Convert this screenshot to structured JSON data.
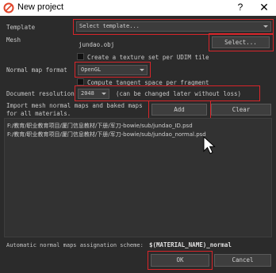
{
  "window": {
    "title": "New project",
    "help_label": "?",
    "close_label": "✕"
  },
  "template": {
    "label": "Template",
    "value": "Select template..."
  },
  "mesh": {
    "label": "Mesh",
    "value": "jundao.obj",
    "select_label": "Select..."
  },
  "udim": {
    "label": "Create a texture set per UDIM tile"
  },
  "normal_map": {
    "label": "Normal map format",
    "value": "OpenGL"
  },
  "tangent": {
    "label": "Compute tangent space per fragment"
  },
  "resolution": {
    "label": "Document resolution",
    "value": "2048",
    "note": "(can be changed later without loss)"
  },
  "import": {
    "label_line1": "Import mesh normal maps and baked maps",
    "label_line2": "for all materials.",
    "add_label": "Add",
    "clear_label": "Clear"
  },
  "files": [
    "F:/教育/职业教育项目/厦门信息教材/下册/军刀-bowie/sub/jundao_ID.psd",
    "F:/教育/职业教育项目/厦门信息教材/下册/军刀-bowie/sub/jundao_normal.psd"
  ],
  "scheme": {
    "label": "Automatic normal maps assignation scheme:",
    "value": "$(MATERIAL_NAME)_normal"
  },
  "footer": {
    "ok_label": "OK",
    "cancel_label": "Cancel"
  },
  "colors": {
    "highlight": "#d9252a",
    "background": "#2b2b2b"
  }
}
